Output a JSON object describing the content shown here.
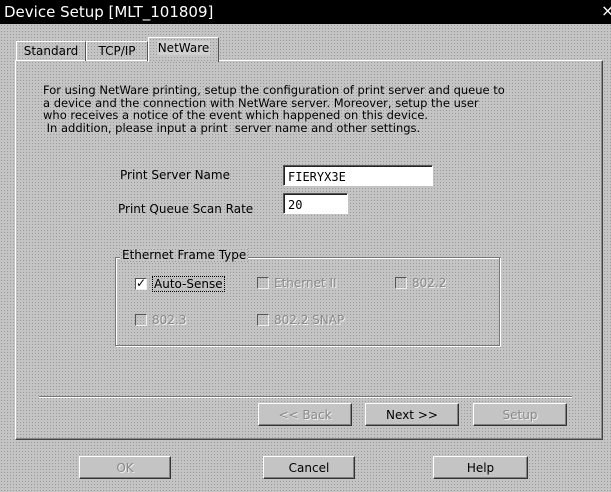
{
  "window": {
    "title": "Device Setup [MLT_101809]",
    "close_glyph": "×"
  },
  "tabs": [
    {
      "label": "Standard",
      "active": false
    },
    {
      "label": "TCP/IP",
      "active": false
    },
    {
      "label": "NetWare",
      "active": true
    }
  ],
  "netware": {
    "description": "For using NetWare printing, setup the configuration of print server and queue to\na device and the connection with NetWare server. Moreover, setup the user\nwho receives a notice of the event which happened on this device.\n In addition, please input a print  server name and other settings.",
    "print_server_name_label": "Print Server Name",
    "print_server_name_value": "FIERYX3E",
    "print_queue_scan_rate_label": "Print Queue Scan Rate",
    "print_queue_scan_rate_value": "20",
    "frame_type": {
      "title": "Ethernet Frame Type",
      "options": [
        {
          "label": "Auto-Sense",
          "checked": true,
          "enabled": true
        },
        {
          "label": "Ethernet II",
          "checked": false,
          "enabled": false
        },
        {
          "label": "802.2",
          "checked": false,
          "enabled": false
        },
        {
          "label": "802.3",
          "checked": false,
          "enabled": false
        },
        {
          "label": "802.2 SNAP",
          "checked": false,
          "enabled": false
        }
      ]
    }
  },
  "wizard_buttons": {
    "back": "<< Back",
    "next": "Next >>",
    "setup": "Setup"
  },
  "dialog_buttons": {
    "ok": "OK",
    "cancel": "Cancel",
    "help": "Help"
  },
  "colors": {
    "titlebar": "#000000",
    "face": "#c4c4c4",
    "disabled_text": "#8a8a8a"
  }
}
